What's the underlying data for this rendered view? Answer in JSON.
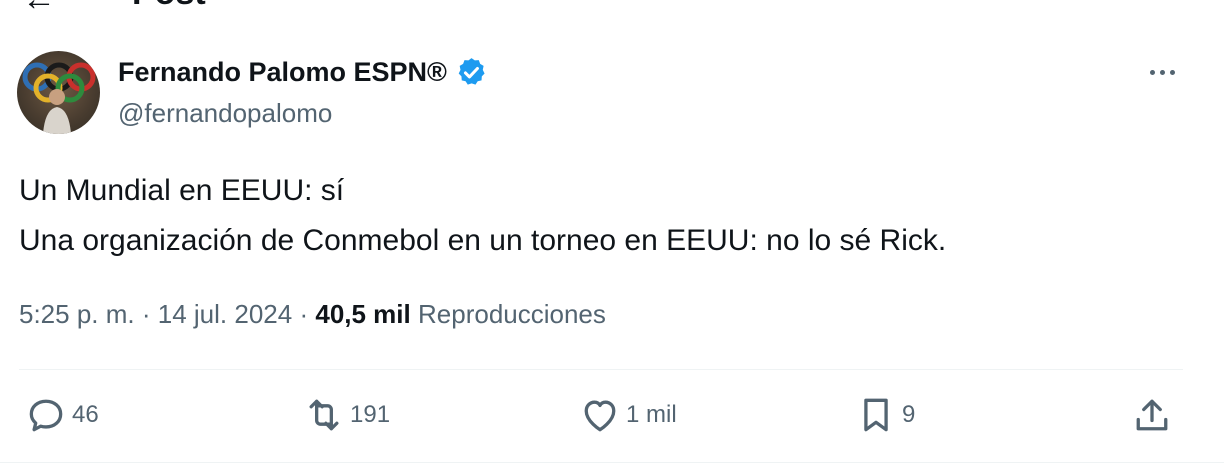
{
  "header": {
    "back_glyph": "←",
    "title": "Post"
  },
  "tweet": {
    "author": {
      "name": "Fernando Palomo ESPN®",
      "handle": "@fernandopalomo",
      "verified_icon": "verified-badge-icon"
    },
    "text_lines": [
      "Un Mundial en EEUU: sí",
      "Una organización de Conmebol en un torneo en EEUU: no lo sé Rick."
    ],
    "time": "5:25 p. m.",
    "date": "14 jul. 2024",
    "separator": "·",
    "views_count": "40,5 mil",
    "views_label": "Reproducciones"
  },
  "actions": {
    "reply_count": "46",
    "repost_count": "191",
    "like_count": "1 mil",
    "bookmark_count": "9"
  },
  "colors": {
    "text": "#0f1419",
    "muted": "#536471",
    "verified": "#1d9bf0",
    "divider": "#eff3f4"
  }
}
